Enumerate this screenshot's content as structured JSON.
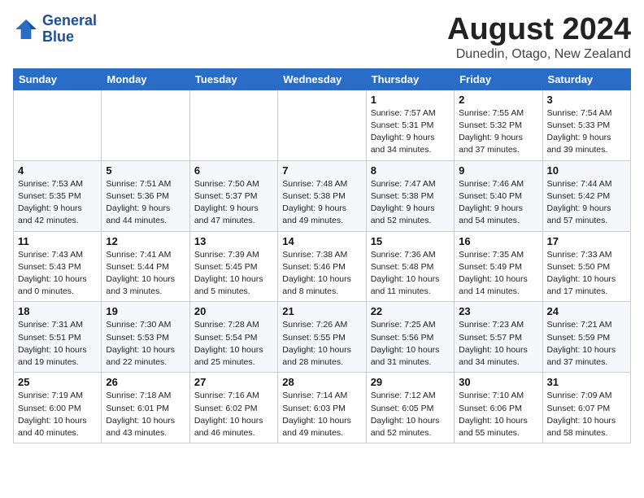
{
  "header": {
    "logo_line1": "General",
    "logo_line2": "Blue",
    "month_year": "August 2024",
    "location": "Dunedin, Otago, New Zealand"
  },
  "weekdays": [
    "Sunday",
    "Monday",
    "Tuesday",
    "Wednesday",
    "Thursday",
    "Friday",
    "Saturday"
  ],
  "weeks": [
    [
      {
        "day": "",
        "info": ""
      },
      {
        "day": "",
        "info": ""
      },
      {
        "day": "",
        "info": ""
      },
      {
        "day": "",
        "info": ""
      },
      {
        "day": "1",
        "info": "Sunrise: 7:57 AM\nSunset: 5:31 PM\nDaylight: 9 hours\nand 34 minutes."
      },
      {
        "day": "2",
        "info": "Sunrise: 7:55 AM\nSunset: 5:32 PM\nDaylight: 9 hours\nand 37 minutes."
      },
      {
        "day": "3",
        "info": "Sunrise: 7:54 AM\nSunset: 5:33 PM\nDaylight: 9 hours\nand 39 minutes."
      }
    ],
    [
      {
        "day": "4",
        "info": "Sunrise: 7:53 AM\nSunset: 5:35 PM\nDaylight: 9 hours\nand 42 minutes."
      },
      {
        "day": "5",
        "info": "Sunrise: 7:51 AM\nSunset: 5:36 PM\nDaylight: 9 hours\nand 44 minutes."
      },
      {
        "day": "6",
        "info": "Sunrise: 7:50 AM\nSunset: 5:37 PM\nDaylight: 9 hours\nand 47 minutes."
      },
      {
        "day": "7",
        "info": "Sunrise: 7:48 AM\nSunset: 5:38 PM\nDaylight: 9 hours\nand 49 minutes."
      },
      {
        "day": "8",
        "info": "Sunrise: 7:47 AM\nSunset: 5:38 PM\nDaylight: 9 hours\nand 52 minutes."
      },
      {
        "day": "9",
        "info": "Sunrise: 7:46 AM\nSunset: 5:40 PM\nDaylight: 9 hours\nand 54 minutes."
      },
      {
        "day": "10",
        "info": "Sunrise: 7:44 AM\nSunset: 5:42 PM\nDaylight: 9 hours\nand 57 minutes."
      }
    ],
    [
      {
        "day": "11",
        "info": "Sunrise: 7:43 AM\nSunset: 5:43 PM\nDaylight: 10 hours\nand 0 minutes."
      },
      {
        "day": "12",
        "info": "Sunrise: 7:41 AM\nSunset: 5:44 PM\nDaylight: 10 hours\nand 3 minutes."
      },
      {
        "day": "13",
        "info": "Sunrise: 7:39 AM\nSunset: 5:45 PM\nDaylight: 10 hours\nand 5 minutes."
      },
      {
        "day": "14",
        "info": "Sunrise: 7:38 AM\nSunset: 5:46 PM\nDaylight: 10 hours\nand 8 minutes."
      },
      {
        "day": "15",
        "info": "Sunrise: 7:36 AM\nSunset: 5:48 PM\nDaylight: 10 hours\nand 11 minutes."
      },
      {
        "day": "16",
        "info": "Sunrise: 7:35 AM\nSunset: 5:49 PM\nDaylight: 10 hours\nand 14 minutes."
      },
      {
        "day": "17",
        "info": "Sunrise: 7:33 AM\nSunset: 5:50 PM\nDaylight: 10 hours\nand 17 minutes."
      }
    ],
    [
      {
        "day": "18",
        "info": "Sunrise: 7:31 AM\nSunset: 5:51 PM\nDaylight: 10 hours\nand 19 minutes."
      },
      {
        "day": "19",
        "info": "Sunrise: 7:30 AM\nSunset: 5:53 PM\nDaylight: 10 hours\nand 22 minutes."
      },
      {
        "day": "20",
        "info": "Sunrise: 7:28 AM\nSunset: 5:54 PM\nDaylight: 10 hours\nand 25 minutes."
      },
      {
        "day": "21",
        "info": "Sunrise: 7:26 AM\nSunset: 5:55 PM\nDaylight: 10 hours\nand 28 minutes."
      },
      {
        "day": "22",
        "info": "Sunrise: 7:25 AM\nSunset: 5:56 PM\nDaylight: 10 hours\nand 31 minutes."
      },
      {
        "day": "23",
        "info": "Sunrise: 7:23 AM\nSunset: 5:57 PM\nDaylight: 10 hours\nand 34 minutes."
      },
      {
        "day": "24",
        "info": "Sunrise: 7:21 AM\nSunset: 5:59 PM\nDaylight: 10 hours\nand 37 minutes."
      }
    ],
    [
      {
        "day": "25",
        "info": "Sunrise: 7:19 AM\nSunset: 6:00 PM\nDaylight: 10 hours\nand 40 minutes."
      },
      {
        "day": "26",
        "info": "Sunrise: 7:18 AM\nSunset: 6:01 PM\nDaylight: 10 hours\nand 43 minutes."
      },
      {
        "day": "27",
        "info": "Sunrise: 7:16 AM\nSunset: 6:02 PM\nDaylight: 10 hours\nand 46 minutes."
      },
      {
        "day": "28",
        "info": "Sunrise: 7:14 AM\nSunset: 6:03 PM\nDaylight: 10 hours\nand 49 minutes."
      },
      {
        "day": "29",
        "info": "Sunrise: 7:12 AM\nSunset: 6:05 PM\nDaylight: 10 hours\nand 52 minutes."
      },
      {
        "day": "30",
        "info": "Sunrise: 7:10 AM\nSunset: 6:06 PM\nDaylight: 10 hours\nand 55 minutes."
      },
      {
        "day": "31",
        "info": "Sunrise: 7:09 AM\nSunset: 6:07 PM\nDaylight: 10 hours\nand 58 minutes."
      }
    ]
  ]
}
